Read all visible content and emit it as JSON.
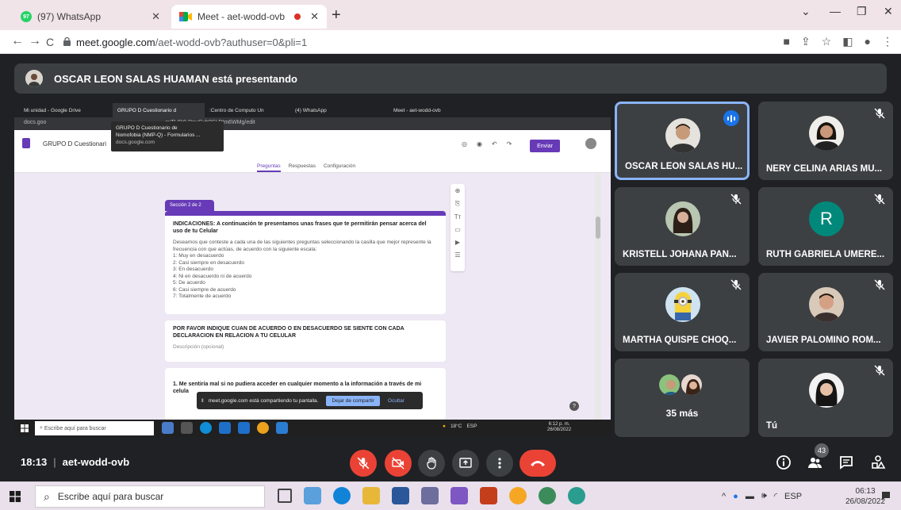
{
  "browser": {
    "tabs": [
      {
        "label": "(97) WhatsApp",
        "badge": "97"
      },
      {
        "label": "Meet - aet-wodd-ovb"
      }
    ],
    "new_tab": "+",
    "url_host": "meet.google.com",
    "url_path": "/aet-wodd-ovb?authuser=0&pli=1"
  },
  "presenter_bar": {
    "text": "OSCAR LEON SALAS HUAMAN está presentando"
  },
  "shared_screen": {
    "tabs": [
      "Mi unidad - Google Drive",
      "GRUPO D Cuestionario d",
      ":Centro de Computo Un",
      "(4) WhatsApp",
      "Meet - aet-wodd-ovb"
    ],
    "address": "docs.goo",
    "address_rest": "sxTL0k8-DnuGyb0SLDtm6WMg/edit",
    "tooltip": {
      "title": "GRUPO D Cuestionario de",
      "subtitle": "Nomofobia (NMP-Q) - Formularios ...",
      "domain": "docs.google.com"
    },
    "form_title": "GRUPO D Cuestionari",
    "form_tabs": [
      "Preguntas",
      "Respuestas",
      "Configuración"
    ],
    "send_button": "Enviar",
    "section_label": "Sección 2 de 2",
    "card1": {
      "title": "INDICACIONES: A continuación te presentamos unas frases que te permitirán pensar acerca del uso de tu Celular",
      "desc": "Deseamos que conteste a cada una de las siguientes preguntas seleccionando la casilla que mejor represente la frecuencia con que actúas, de acuerdo con la siguiente escala:",
      "scale": [
        "1: Muy en desacuerdo",
        "2: Casi siempre en desacuerdo",
        "3: En desacuerdo",
        "4: Ni en desacuerdo ni de acuerdo",
        "5: De acuerdo",
        "6: Casi siempre de acuerdo",
        "7: Totalmente de acuerdo"
      ]
    },
    "card2": {
      "title": "POR FAVOR INDIQUE CUAN DE ACUERDO O EN DESACUERDO SE SIENTE CON CADA DECLARACION EN RELACION A TU CELULAR",
      "hint": "Descripción (opcional)"
    },
    "card3": {
      "title": "1. Me sentiría mal si no pudiera acceder en cualquier momento a la información a través de mi celula"
    },
    "share_banner": {
      "text": "meet.google.com está compartiendo tu pantalla.",
      "button": "Dejar de compartir",
      "hide": "Ocultar"
    },
    "taskbar": {
      "search": "Escribe aquí para buscar",
      "weather": "18°C",
      "lang": "ESP",
      "time": "6:12 p. m.",
      "date": "26/08/2022"
    }
  },
  "participants": [
    {
      "name": "OSCAR LEON SALAS HU...",
      "speaking": true
    },
    {
      "name": "NERY CELINA ARIAS MU...",
      "muted": true
    },
    {
      "name": "KRISTELL JOHANA PAN...",
      "muted": true
    },
    {
      "name": "RUTH GABRIELA UMERE...",
      "muted": true,
      "initial": "R"
    },
    {
      "name": "MARTHA QUISPE CHOQ...",
      "muted": true
    },
    {
      "name": "JAVIER PALOMINO ROM...",
      "muted": true
    },
    {
      "more": "35 más"
    },
    {
      "name": "Tú",
      "muted": true
    }
  ],
  "meeting": {
    "time": "18:13",
    "separator": "|",
    "code": "aet-wodd-ovb",
    "participant_count": "43"
  },
  "colors": {
    "accent_red": "#ea4335",
    "form_purple": "#673ab7",
    "meet_bg": "#202124",
    "tile_bg": "#3c4043",
    "speaking_border": "#8ab4f8"
  },
  "windows_taskbar": {
    "search": "Escribe aquí para buscar",
    "lang": "ESP",
    "time": "06:13",
    "date": "26/08/2022"
  }
}
